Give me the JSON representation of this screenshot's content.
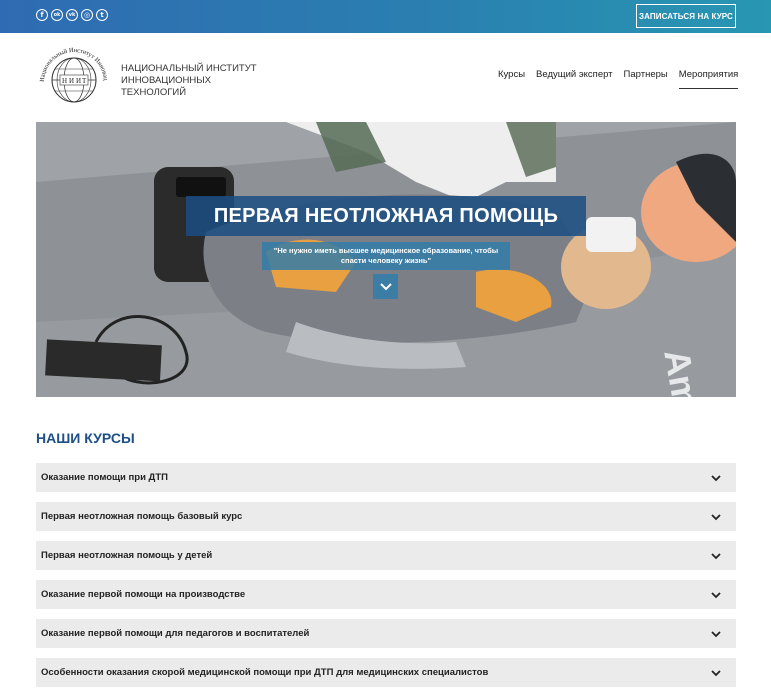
{
  "topbar": {
    "social": [
      {
        "icon": "facebook-icon",
        "glyph": "f"
      },
      {
        "icon": "odnoklassniki-icon",
        "glyph": "ok"
      },
      {
        "icon": "vk-icon",
        "glyph": "vk"
      },
      {
        "icon": "instagram-icon",
        "glyph": "◎"
      },
      {
        "icon": "twitter-icon",
        "glyph": "t"
      }
    ],
    "enroll_label": "ЗАПИСАТЬСЯ НА КУРС"
  },
  "header": {
    "logo_text_top": "Национальный Институт Инновационных Технологий",
    "logo_letters": [
      "Н",
      "И",
      "И",
      "Т"
    ],
    "org_line1": "НАЦИОНАЛЬНЫЙ ИНСТИТУТ",
    "org_line2": "ИННОВАЦИОННЫХ ТЕХНОЛОГИЙ",
    "nav": [
      {
        "label": "Курсы"
      },
      {
        "label": "Ведущий эксперт"
      },
      {
        "label": "Партнеры"
      },
      {
        "label": "Мероприятия",
        "active": true
      }
    ]
  },
  "hero": {
    "title": "ПЕРВАЯ НЕОТЛОЖНАЯ ПОМОЩЬ",
    "subtitle_line1": "\"Не нужно иметь высшее медицинское образование, чтобы",
    "subtitle_line2": "спасти человеку жизнь\"",
    "mat_text": "Ambu"
  },
  "courses": {
    "title": "НАШИ КУРСЫ",
    "items": [
      {
        "label": "Оказание помощи при ДТП"
      },
      {
        "label": "Первая неотложная помощь базовый курс"
      },
      {
        "label": "Первая неотложная помощь у детей"
      },
      {
        "label": "Оказание первой помощи на производстве"
      },
      {
        "label": "Оказание первой помощи для педагогов и воспитателей"
      },
      {
        "label": "Особенности оказания скорой медицинской помощи при ДТП для медицинских специалистов"
      }
    ]
  },
  "colors": {
    "topbar_start": "#2f6bb2",
    "topbar_end": "#2897b2",
    "heading": "#1d4f86",
    "course_bg": "#ebebeb"
  }
}
